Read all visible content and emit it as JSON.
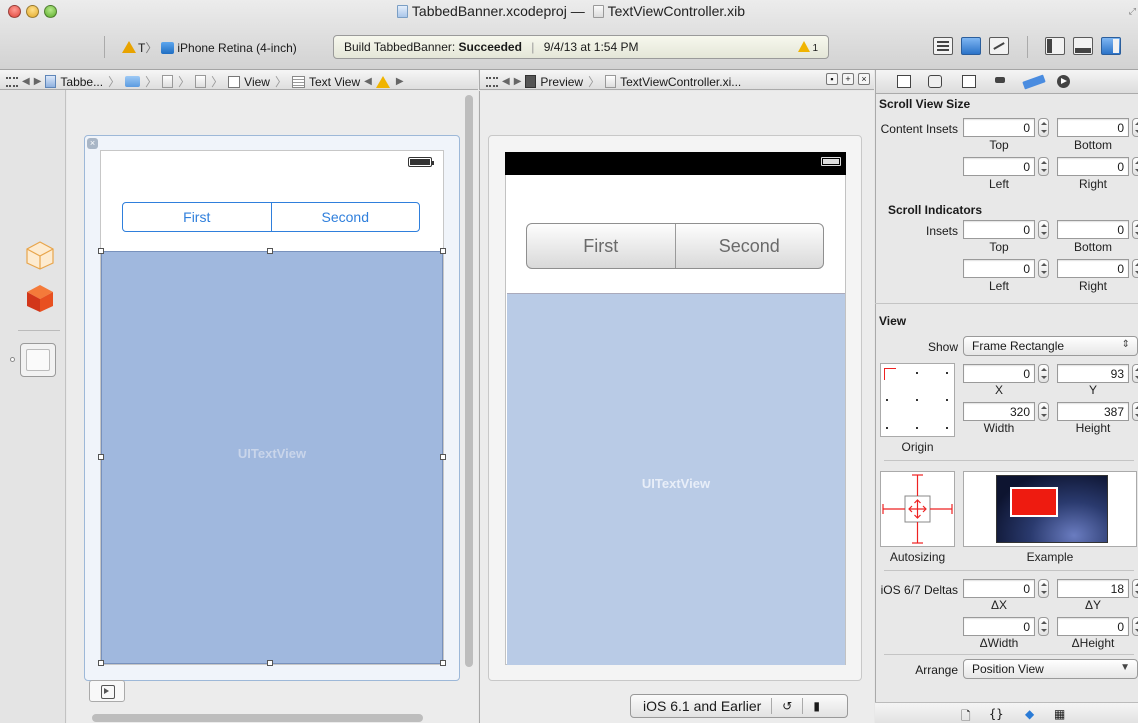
{
  "window": {
    "title_project": "TabbedBanner.xcodeproj",
    "title_sep": "—",
    "title_file": "TextViewController.xib"
  },
  "toolbar": {
    "scheme_target": "T",
    "scheme_sep": "〉",
    "scheme_device": "iPhone Retina (4-inch)",
    "activity_prefix": "Build TabbedBanner:",
    "activity_status": "Succeeded",
    "activity_pipe": "|",
    "activity_date": "9/4/13 at 1:54 PM",
    "warning_count": "1"
  },
  "jumpbar_left": {
    "crumbs": [
      "Tabbe...",
      "View",
      "Text View"
    ],
    "sep": "〉"
  },
  "jumpbar_right": {
    "crumbs": [
      "Preview",
      "TextViewController.xi..."
    ],
    "sep": "〉"
  },
  "canvas": {
    "segments": [
      "First",
      "Second"
    ],
    "textview_label": "UITextView"
  },
  "preview": {
    "segments": [
      "First",
      "Second"
    ],
    "textview_label": "UITextView",
    "ios_version": "iOS 6.1 and Earlier",
    "orientation_sep": "|"
  },
  "inspector": {
    "scroll_view_size": {
      "title": "Scroll View Size",
      "content_insets_label": "Content Insets",
      "top": "0",
      "bottom": "0",
      "left": "0",
      "right": "0",
      "top_label": "Top",
      "bottom_label": "Bottom",
      "left_label": "Left",
      "right_label": "Right"
    },
    "scroll_indicators": {
      "title": "Scroll Indicators",
      "insets_label": "Insets",
      "top": "0",
      "bottom": "0",
      "left": "0",
      "right": "0",
      "top_label": "Top",
      "bottom_label": "Bottom",
      "left_label": "Left",
      "right_label": "Right"
    },
    "view": {
      "title": "View",
      "show_label": "Show",
      "show_value": "Frame Rectangle",
      "x": "0",
      "y": "93",
      "width": "320",
      "height": "387",
      "x_label": "X",
      "y_label": "Y",
      "width_label": "Width",
      "height_label": "Height",
      "origin_label": "Origin",
      "autosizing_label": "Autosizing",
      "example_label": "Example",
      "deltas_label": "iOS 6/7 Deltas",
      "dx": "0",
      "dy": "18",
      "dwidth": "0",
      "dheight": "0",
      "dx_label": "ΔX",
      "dy_label": "ΔY",
      "dwidth_label": "ΔWidth",
      "dheight_label": "ΔHeight",
      "arrange_label": "Arrange",
      "arrange_value": "Position View"
    },
    "bottom_icons": [
      "file-template-icon",
      "code-snippet-icon",
      "object-library-icon",
      "media-library-icon"
    ],
    "bottom_glyphs": [
      "{}"
    ]
  },
  "colors": {
    "ios7_tint": "#2f7fdc",
    "textview_fill": "#a0b8de",
    "warning": "#f0b400"
  }
}
